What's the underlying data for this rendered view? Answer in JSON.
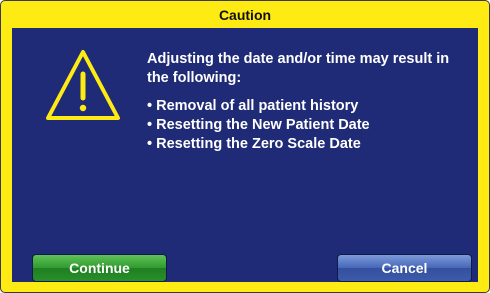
{
  "dialog": {
    "title": "Caution",
    "message_intro": "Adjusting the date and/or time may result in the following:",
    "bullets": [
      "Removal of all patient history",
      "Resetting the New Patient Date",
      "Resetting the Zero Scale Date"
    ],
    "icon": "warning-triangle",
    "continue_label": "Continue",
    "cancel_label": "Cancel"
  },
  "colors": {
    "frame": "#ffeb14",
    "panel": "#1f2b76",
    "continue_button": "#2f9a2d",
    "cancel_button": "#4667b8",
    "text": "#ffffff"
  }
}
